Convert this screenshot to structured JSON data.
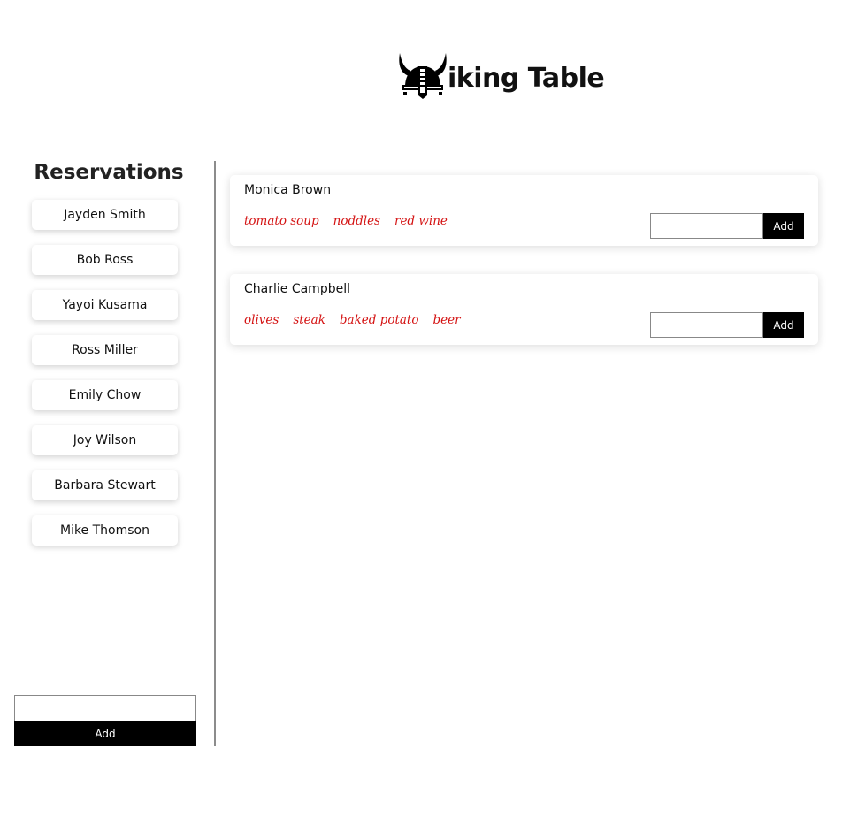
{
  "header": {
    "logo_text": "iking Table",
    "logo_icon": "viking-helmet-icon"
  },
  "sidebar": {
    "title": "Reservations",
    "items": [
      {
        "label": "Jayden Smith"
      },
      {
        "label": "Bob Ross"
      },
      {
        "label": "Yayoi Kusama"
      },
      {
        "label": "Ross Miller"
      },
      {
        "label": "Emily Chow"
      },
      {
        "label": "Joy Wilson"
      },
      {
        "label": "Barbara Stewart"
      },
      {
        "label": "Mike Thomson"
      }
    ],
    "input_value": "",
    "add_label": "Add"
  },
  "customers": [
    {
      "name": "Monica Brown",
      "foods": [
        "tomato soup",
        "noddles",
        "red wine"
      ],
      "input_value": "",
      "add_label": "Add"
    },
    {
      "name": "Charlie Campbell",
      "foods": [
        "olives",
        "steak",
        "baked potato",
        "beer"
      ],
      "input_value": "",
      "add_label": "Add"
    }
  ],
  "colors": {
    "food_text": "#d41212",
    "button_bg": "#000000",
    "divider": "#8c8c8c"
  }
}
